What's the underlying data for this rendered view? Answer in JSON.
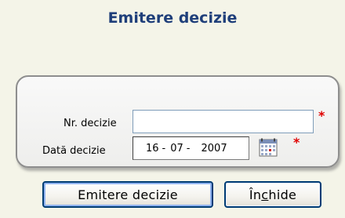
{
  "title": "Emitere decizie",
  "form": {
    "nr_decizie": {
      "label": "Nr. decizie",
      "value": "",
      "required_marker": "*"
    },
    "data_decizie": {
      "label": "Dată decizie",
      "day": "16",
      "month": "07",
      "year": "2007",
      "separator": "-",
      "required_marker": "*"
    }
  },
  "buttons": {
    "submit_label": "Emitere decizie",
    "close_label": "Închide",
    "close_hotkey": "c"
  },
  "colors": {
    "title": "#1f3f7a",
    "required": "#e00000",
    "button_border": "#003c74",
    "background": "#f4f4e8"
  },
  "icons": {
    "calendar": "calendar-icon"
  }
}
